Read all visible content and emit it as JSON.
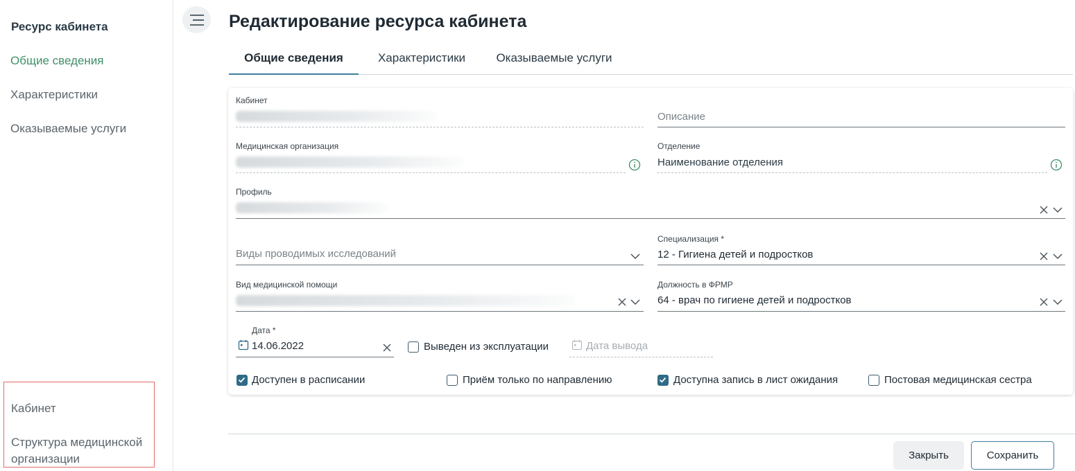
{
  "sidebar": {
    "title": "Ресурс кабинета",
    "items": [
      {
        "label": "Общие сведения",
        "active": true
      },
      {
        "label": "Характеристики",
        "active": false
      },
      {
        "label": "Оказываемые услуги",
        "active": false
      }
    ],
    "bottom_links": [
      {
        "label": "Кабинет"
      },
      {
        "label": "Структура медицинской организации"
      }
    ]
  },
  "header": {
    "title": "Редактирование ресурса кабинета"
  },
  "tabs": [
    {
      "label": "Общие сведения",
      "active": true
    },
    {
      "label": "Характеристики",
      "active": false
    },
    {
      "label": "Оказываемые услуги",
      "active": false
    }
  ],
  "form": {
    "cabinet": {
      "label": "Кабинет",
      "value": ""
    },
    "description": {
      "placeholder": "Описание"
    },
    "med_org": {
      "label": "Медицинская организация",
      "value": ""
    },
    "department": {
      "label": "Отделение",
      "value": "Наименование отделения"
    },
    "profile": {
      "label": "Профиль",
      "value": ""
    },
    "research_types": {
      "placeholder": "Виды проводимых исследований"
    },
    "specialization": {
      "label": "Специализация *",
      "value": "12 - Гигиена детей и подростков"
    },
    "care_type": {
      "label": "Вид медицинской помощи",
      "value": ""
    },
    "position_frmr": {
      "label": "Должность в ФРМР",
      "value": "64 - врач по гигиене детей и подростков"
    },
    "date": {
      "label": "Дата *",
      "value": "14.06.2022"
    },
    "decommissioned": {
      "label": "Выведен из эксплуатации",
      "checked": false
    },
    "decommission_date": {
      "placeholder": "Дата вывода"
    },
    "checkboxes": [
      {
        "label": "Доступен в расписании",
        "checked": true
      },
      {
        "label": "Приём только по направлению",
        "checked": false
      },
      {
        "label": "Доступна запись в лист ожидания",
        "checked": true
      },
      {
        "label": "Постовая медицинская сестра",
        "checked": false
      }
    ]
  },
  "buttons": {
    "close": "Закрыть",
    "save": "Сохранить"
  },
  "colors": {
    "accent": "#3f7d9c",
    "active_sidebar": "#3f8f68",
    "checkbox_checked": "#2f6b87",
    "highlight_box": "#e06a6a"
  }
}
